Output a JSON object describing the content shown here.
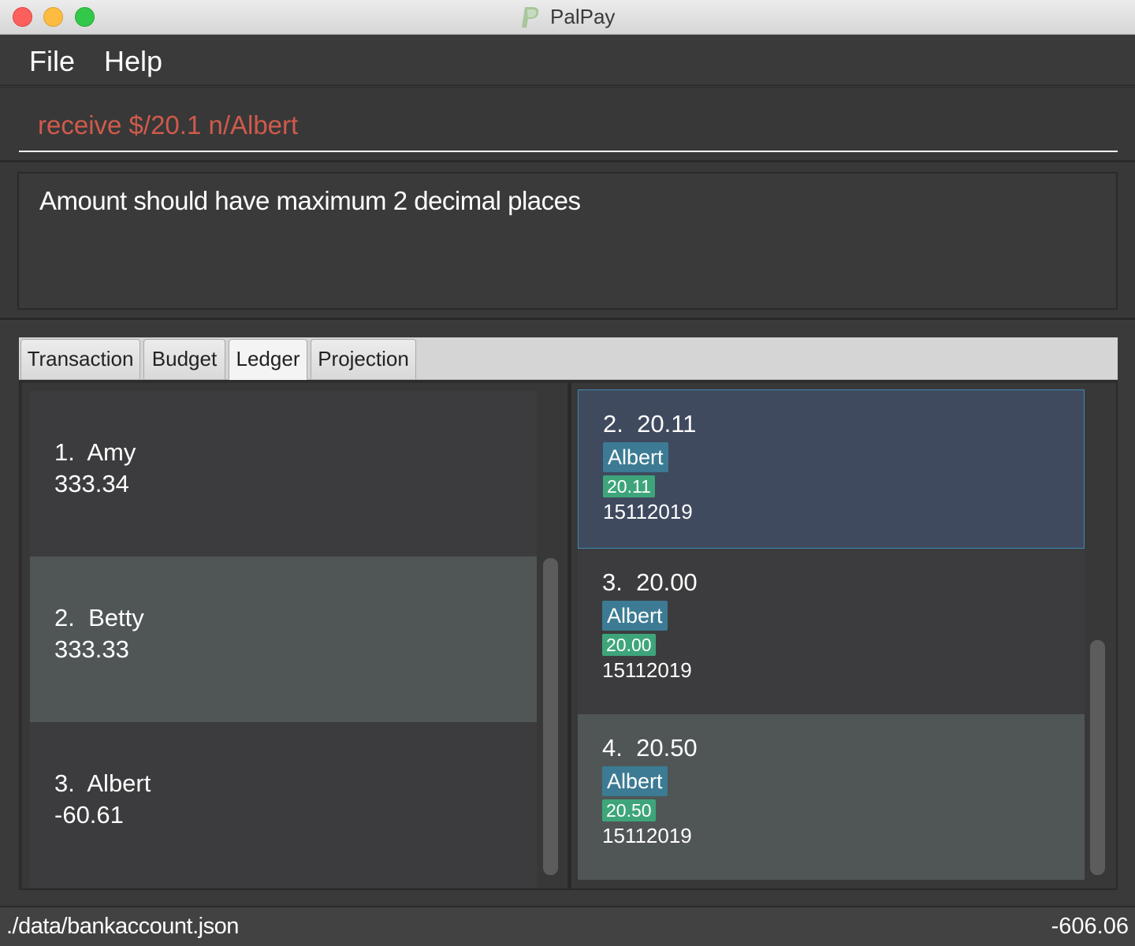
{
  "window": {
    "title": "PalPay"
  },
  "menu": {
    "file": "File",
    "help": "Help"
  },
  "command_box": {
    "value": "receive $/20.1 n/Albert"
  },
  "result_display": {
    "message": "Amount should have maximum 2 decimal places"
  },
  "tabs": [
    {
      "label": "Transaction",
      "active": false
    },
    {
      "label": "Budget",
      "active": false
    },
    {
      "label": "Ledger",
      "active": true
    },
    {
      "label": "Projection",
      "active": false
    }
  ],
  "people": [
    {
      "index": "1.",
      "name": "Amy",
      "balance": "333.34"
    },
    {
      "index": "2.",
      "name": "Betty",
      "balance": "333.33"
    },
    {
      "index": "3.",
      "name": "Albert",
      "balance": "-60.61"
    }
  ],
  "ledger_transactions": [
    {
      "index": "2.",
      "amount": "20.11",
      "person": "Albert",
      "tag_amount": "20.11",
      "date": "15112019",
      "selected": true
    },
    {
      "index": "3.",
      "amount": "20.00",
      "person": "Albert",
      "tag_amount": "20.00",
      "date": "15112019",
      "selected": false
    },
    {
      "index": "4.",
      "amount": "20.50",
      "person": "Albert",
      "tag_amount": "20.50",
      "date": "15112019",
      "selected": false
    }
  ],
  "status_bar": {
    "file_path": "./data/bankaccount.json",
    "balance": "-606.06"
  },
  "colors": {
    "command_text": "#d05a4c",
    "name_tag": "#3c7b93",
    "amount_tag": "#3ea57a",
    "selected_card": "#3f4a5e"
  }
}
